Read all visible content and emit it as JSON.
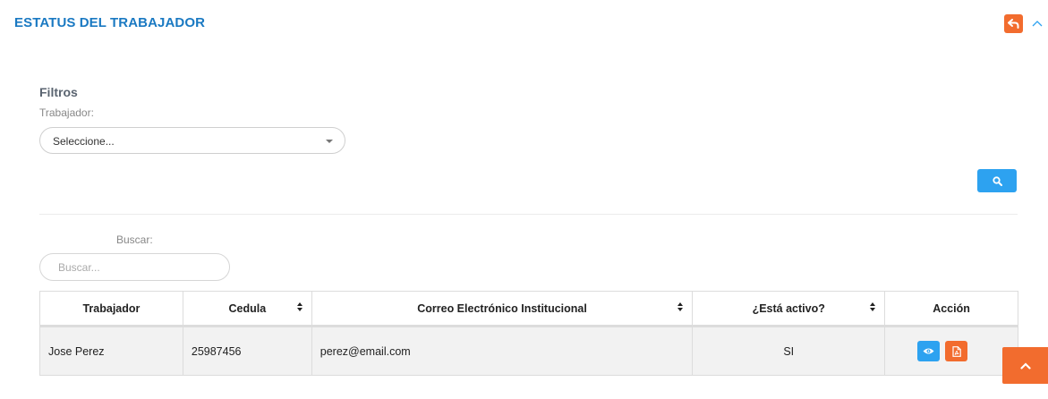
{
  "header": {
    "title": "ESTATUS DEL TRABAJADOR",
    "back_icon": "undo-arrow-icon",
    "collapse_icon": "chevron-up-icon",
    "accent_color": "#1a79c2",
    "orange": "#f26c2e"
  },
  "filters": {
    "title": "Filtros",
    "worker_label": "Trabajador:",
    "worker_select_value": "Seleccione...",
    "search_button_icon": "search-icon"
  },
  "search": {
    "label": "Buscar:",
    "placeholder": "Buscar..."
  },
  "table": {
    "columns": [
      "Trabajador",
      "Cedula",
      "Correo Electrónico Institucional",
      "¿Está activo?",
      "Acción"
    ],
    "rows": [
      {
        "worker": "Jose Perez",
        "cedula": "25987456",
        "email": "perez@email.com",
        "active": "SI",
        "actions": [
          "eye-icon",
          "pdf-file-icon"
        ]
      }
    ]
  },
  "scroll_top_icon": "chevron-up-icon",
  "blue": "#2da2f0"
}
